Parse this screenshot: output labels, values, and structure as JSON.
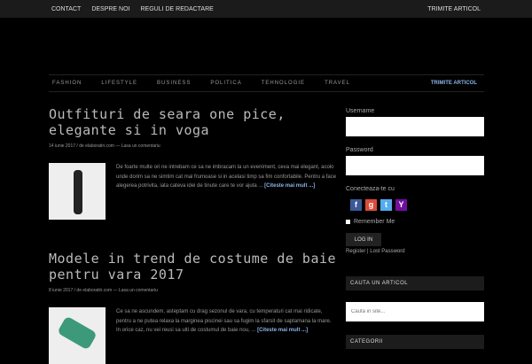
{
  "topbar": {
    "links": [
      "CONTACT",
      "DESPRE NOI",
      "REGULI DE REDACTARE"
    ],
    "submit": "TRIMITE ARTICOL"
  },
  "nav": {
    "items": [
      "FASHION",
      "LIFESTYLE",
      "BUSINESS",
      "POLITICA",
      "TEHNOLOGIE",
      "TRAVEL"
    ],
    "submit": "TRIMITE ARTICOL"
  },
  "posts": [
    {
      "title": "Outfituri de seara one pice, elegante si in voga",
      "date": "14 iunie 2017",
      "author": "de elaboratiri.com",
      "comments": "Lasa un comentariu",
      "excerpt": "De foarte multe ori ne intrebam ce sa ne imbracam la un eveniment, ceva mai elegant, acolo unde dorim sa ne simtim cat mai frumoase si in acelasi timp sa fim confortabile. Pentru a face alegerea potrivita, iata cateva idei de tinute care te vor ajuta ...",
      "more": "[Citeste mai mult ...]"
    },
    {
      "title": "Modele in trend de costume de baie pentru vara 2017",
      "date": "8 iunie 2017",
      "author": "de elaboratiri.com",
      "comments": "Lasa un comentariu",
      "excerpt": "Ce sa ne ascundem, asteptam cu drag sezonul de vara, cu temperaturi cat mai ridicate, pentru a ne putea relaxa la marginea piscinei sau sa fugim la sfarsit de saptamana la mare. In orice caz, nu vei reusi sa uiti de costumul de baie nou, ...",
      "more": "[Citeste mai mult ...]"
    }
  ],
  "login": {
    "username_label": "Username",
    "password_label": "Password",
    "connect_label": "Conecteaza-te cu",
    "remember": "Remember Me",
    "login_button": "LOG IN",
    "register": "Register",
    "lost": "Lost Password"
  },
  "search": {
    "title": "CAUTA UN ARTICOL",
    "placeholder": "Cauta in site..."
  },
  "categories": {
    "title": "CATEGORII"
  }
}
